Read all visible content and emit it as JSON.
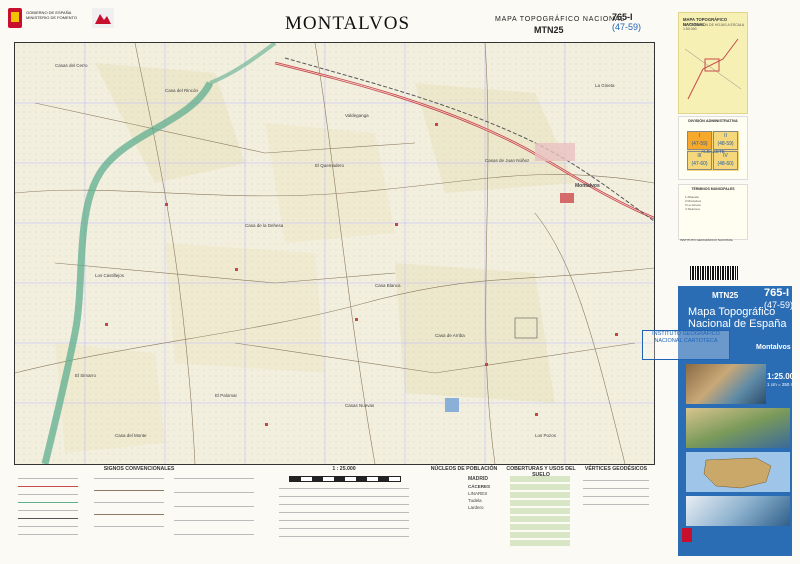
{
  "header": {
    "gov_text": "GOBIERNO DE ESPAÑA   MINISTERIO DE FOMENTO",
    "title": "MONTALVOS",
    "series": "MAPA TOPOGRÁFICO NACIONAL",
    "mtn": "MTN25",
    "sheet_no": "765-I",
    "sheet_sub": "(47-59)"
  },
  "map": {
    "place_labels": [
      "Casas del Cerro",
      "Casa del Rincón",
      "Valdeganga",
      "El Quemadero",
      "Casa de la Dehesa",
      "Casas de Juan Núñez",
      "Los Castillejos",
      "Casa Blanca",
      "Montalvos",
      "La Gineta",
      "El Simarro",
      "Casa de Arriba",
      "El Palomar",
      "Los Pozos",
      "Casa del Monte",
      "Casas Nuevas"
    ],
    "colors": {
      "background": "#f4f1e4",
      "field": "#ece6c8",
      "river": "#5fae8f",
      "road": "#c84a4a",
      "rail": "#555555",
      "grid": "#b7b7ff"
    }
  },
  "legend": {
    "signos_title": "SIGNOS CONVENCIONALES",
    "scale_title": "1 : 25.000",
    "nucleos_title": "NÚCLEOS DE POBLACIÓN",
    "nucleos_names": [
      "MADRID",
      "CÁCERES",
      "LINARES",
      "Tudela",
      "Lardero"
    ],
    "cobertura_title": "COBERTURAS Y USOS DEL SUELO",
    "vertices_title": "VÉRTICES GEODÉSICOS"
  },
  "right_panel": {
    "top_title": "MAPA TOPOGRÁFICO NACIONAL",
    "top_sub": "DISTRIBUCIÓN DE HOJAS A ESCALA 1:50.000",
    "admin_title": "DIVISIÓN ADMINISTRATIVA",
    "province": "ALBACETE",
    "cells": [
      {
        "label": "I",
        "sub": "(47-59)"
      },
      {
        "label": "II",
        "sub": "(48-59)"
      },
      {
        "label": "III",
        "sub": "(47-60)"
      },
      {
        "label": "IV",
        "sub": "(48-60)"
      }
    ],
    "mun_title": "TÉRMINOS MUNICIPALES",
    "mun_text": "1 Albacete\n2 Montalvos\n3 La Gineta\n4 Tarazona",
    "institute_text": "INSTITUTO GEOGRÁFICO NACIONAL",
    "blue_mtn": "MTN25",
    "blue_no": "765-I",
    "blue_sub": "(47-59)",
    "blue_title": "Mapa Topográfico Nacional de España",
    "blue_name": "Montalvos",
    "blue_scale": "1:25.000",
    "blue_scale2": "1 cm = 250 m",
    "stamp": "INSTITUTO GEOGRÁFICO NACIONAL CARTOTECA"
  }
}
